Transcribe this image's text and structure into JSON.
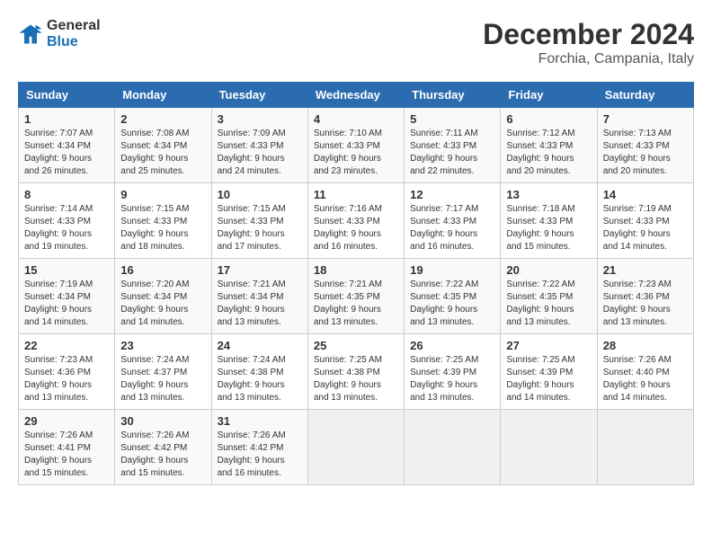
{
  "header": {
    "logo_line1": "General",
    "logo_line2": "Blue",
    "month_title": "December 2024",
    "location": "Forchia, Campania, Italy"
  },
  "days_of_week": [
    "Sunday",
    "Monday",
    "Tuesday",
    "Wednesday",
    "Thursday",
    "Friday",
    "Saturday"
  ],
  "weeks": [
    [
      {
        "day": "1",
        "sunrise": "7:07 AM",
        "sunset": "4:34 PM",
        "daylight": "9 hours and 26 minutes."
      },
      {
        "day": "2",
        "sunrise": "7:08 AM",
        "sunset": "4:34 PM",
        "daylight": "9 hours and 25 minutes."
      },
      {
        "day": "3",
        "sunrise": "7:09 AM",
        "sunset": "4:33 PM",
        "daylight": "9 hours and 24 minutes."
      },
      {
        "day": "4",
        "sunrise": "7:10 AM",
        "sunset": "4:33 PM",
        "daylight": "9 hours and 23 minutes."
      },
      {
        "day": "5",
        "sunrise": "7:11 AM",
        "sunset": "4:33 PM",
        "daylight": "9 hours and 22 minutes."
      },
      {
        "day": "6",
        "sunrise": "7:12 AM",
        "sunset": "4:33 PM",
        "daylight": "9 hours and 20 minutes."
      },
      {
        "day": "7",
        "sunrise": "7:13 AM",
        "sunset": "4:33 PM",
        "daylight": "9 hours and 20 minutes."
      }
    ],
    [
      {
        "day": "8",
        "sunrise": "7:14 AM",
        "sunset": "4:33 PM",
        "daylight": "9 hours and 19 minutes."
      },
      {
        "day": "9",
        "sunrise": "7:15 AM",
        "sunset": "4:33 PM",
        "daylight": "9 hours and 18 minutes."
      },
      {
        "day": "10",
        "sunrise": "7:15 AM",
        "sunset": "4:33 PM",
        "daylight": "9 hours and 17 minutes."
      },
      {
        "day": "11",
        "sunrise": "7:16 AM",
        "sunset": "4:33 PM",
        "daylight": "9 hours and 16 minutes."
      },
      {
        "day": "12",
        "sunrise": "7:17 AM",
        "sunset": "4:33 PM",
        "daylight": "9 hours and 16 minutes."
      },
      {
        "day": "13",
        "sunrise": "7:18 AM",
        "sunset": "4:33 PM",
        "daylight": "9 hours and 15 minutes."
      },
      {
        "day": "14",
        "sunrise": "7:19 AM",
        "sunset": "4:33 PM",
        "daylight": "9 hours and 14 minutes."
      }
    ],
    [
      {
        "day": "15",
        "sunrise": "7:19 AM",
        "sunset": "4:34 PM",
        "daylight": "9 hours and 14 minutes."
      },
      {
        "day": "16",
        "sunrise": "7:20 AM",
        "sunset": "4:34 PM",
        "daylight": "9 hours and 14 minutes."
      },
      {
        "day": "17",
        "sunrise": "7:21 AM",
        "sunset": "4:34 PM",
        "daylight": "9 hours and 13 minutes."
      },
      {
        "day": "18",
        "sunrise": "7:21 AM",
        "sunset": "4:35 PM",
        "daylight": "9 hours and 13 minutes."
      },
      {
        "day": "19",
        "sunrise": "7:22 AM",
        "sunset": "4:35 PM",
        "daylight": "9 hours and 13 minutes."
      },
      {
        "day": "20",
        "sunrise": "7:22 AM",
        "sunset": "4:35 PM",
        "daylight": "9 hours and 13 minutes."
      },
      {
        "day": "21",
        "sunrise": "7:23 AM",
        "sunset": "4:36 PM",
        "daylight": "9 hours and 13 minutes."
      }
    ],
    [
      {
        "day": "22",
        "sunrise": "7:23 AM",
        "sunset": "4:36 PM",
        "daylight": "9 hours and 13 minutes."
      },
      {
        "day": "23",
        "sunrise": "7:24 AM",
        "sunset": "4:37 PM",
        "daylight": "9 hours and 13 minutes."
      },
      {
        "day": "24",
        "sunrise": "7:24 AM",
        "sunset": "4:38 PM",
        "daylight": "9 hours and 13 minutes."
      },
      {
        "day": "25",
        "sunrise": "7:25 AM",
        "sunset": "4:38 PM",
        "daylight": "9 hours and 13 minutes."
      },
      {
        "day": "26",
        "sunrise": "7:25 AM",
        "sunset": "4:39 PM",
        "daylight": "9 hours and 13 minutes."
      },
      {
        "day": "27",
        "sunrise": "7:25 AM",
        "sunset": "4:39 PM",
        "daylight": "9 hours and 14 minutes."
      },
      {
        "day": "28",
        "sunrise": "7:26 AM",
        "sunset": "4:40 PM",
        "daylight": "9 hours and 14 minutes."
      }
    ],
    [
      {
        "day": "29",
        "sunrise": "7:26 AM",
        "sunset": "4:41 PM",
        "daylight": "9 hours and 15 minutes."
      },
      {
        "day": "30",
        "sunrise": "7:26 AM",
        "sunset": "4:42 PM",
        "daylight": "9 hours and 15 minutes."
      },
      {
        "day": "31",
        "sunrise": "7:26 AM",
        "sunset": "4:42 PM",
        "daylight": "9 hours and 16 minutes."
      },
      null,
      null,
      null,
      null
    ]
  ],
  "labels": {
    "sunrise": "Sunrise:",
    "sunset": "Sunset:",
    "daylight": "Daylight:"
  }
}
